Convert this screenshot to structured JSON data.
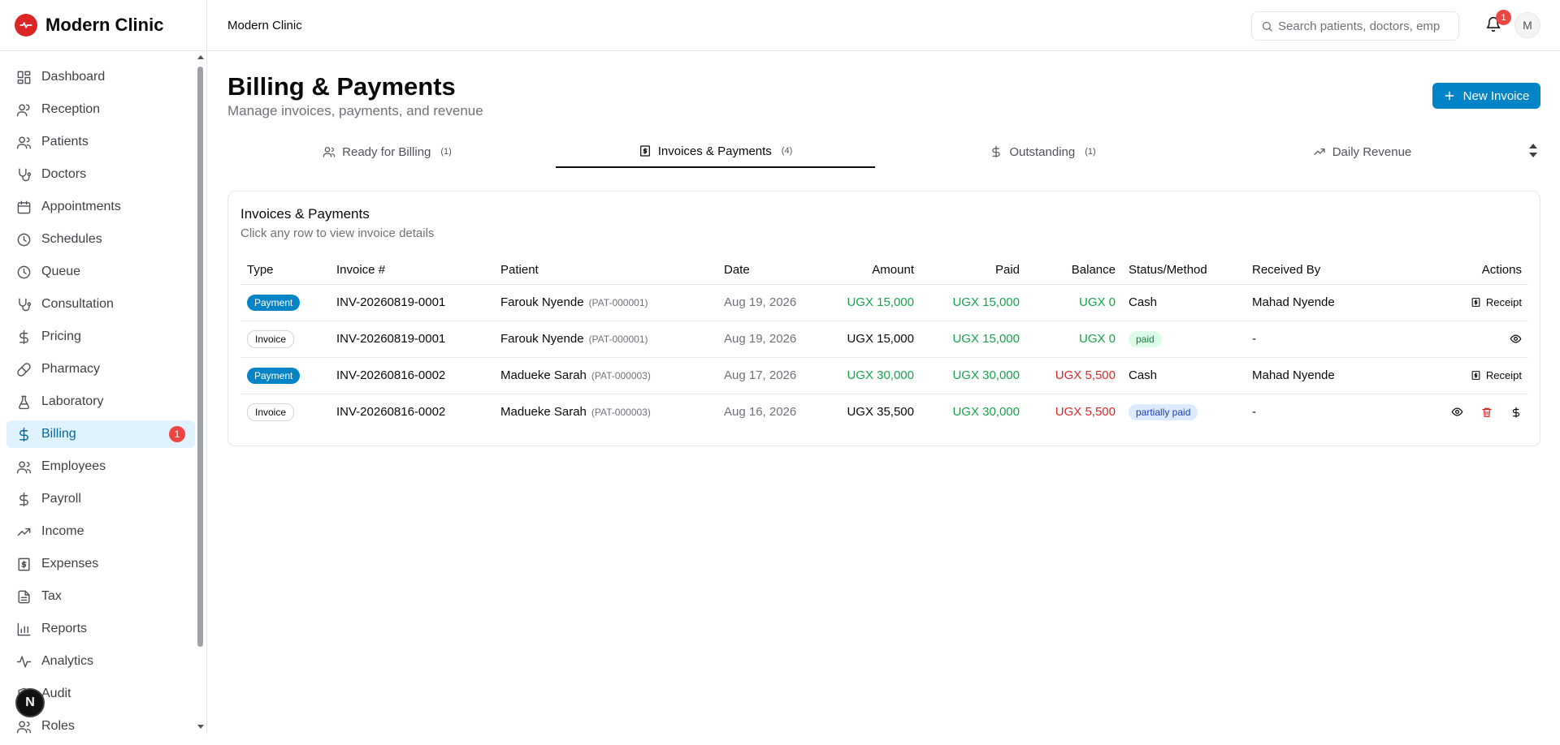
{
  "brand": {
    "name": "Modern Clinic",
    "color": "#dc2626"
  },
  "header": {
    "title": "Modern Clinic",
    "search_placeholder": "Search patients, doctors, emp",
    "notification_count": "1",
    "avatar_initial": "M"
  },
  "sidebar": {
    "items": [
      {
        "label": "Dashboard",
        "icon": "dashboard-icon"
      },
      {
        "label": "Reception",
        "icon": "user-icon"
      },
      {
        "label": "Patients",
        "icon": "users-icon"
      },
      {
        "label": "Doctors",
        "icon": "stethoscope-icon"
      },
      {
        "label": "Appointments",
        "icon": "calendar-icon"
      },
      {
        "label": "Schedules",
        "icon": "clock-icon"
      },
      {
        "label": "Queue",
        "icon": "clock-icon"
      },
      {
        "label": "Consultation",
        "icon": "stethoscope-icon"
      },
      {
        "label": "Pricing",
        "icon": "dollar-icon"
      },
      {
        "label": "Pharmacy",
        "icon": "pill-icon"
      },
      {
        "label": "Laboratory",
        "icon": "flask-icon"
      },
      {
        "label": "Billing",
        "icon": "dollar-icon",
        "badge": "1",
        "active": true
      },
      {
        "label": "Employees",
        "icon": "users-icon"
      },
      {
        "label": "Payroll",
        "icon": "dollar-icon"
      },
      {
        "label": "Income",
        "icon": "trending-up-icon"
      },
      {
        "label": "Expenses",
        "icon": "receipt-icon"
      },
      {
        "label": "Tax",
        "icon": "file-text-icon"
      },
      {
        "label": "Reports",
        "icon": "bar-chart-icon"
      },
      {
        "label": "Analytics",
        "icon": "activity-icon"
      },
      {
        "label": "Audit",
        "icon": "shield-icon"
      },
      {
        "label": "Roles",
        "icon": "users-icon"
      }
    ],
    "dev_badge": "N"
  },
  "page": {
    "title": "Billing & Payments",
    "subtitle": "Manage invoices, payments, and revenue",
    "new_invoice_label": "New Invoice"
  },
  "tabs": [
    {
      "label": "Ready for Billing",
      "count": "(1)"
    },
    {
      "label": "Invoices & Payments",
      "count": "(4)",
      "active": true
    },
    {
      "label": "Outstanding",
      "count": "(1)"
    },
    {
      "label": "Daily Revenue",
      "count": ""
    }
  ],
  "card": {
    "title": "Invoices & Payments",
    "description": "Click any row to view invoice details"
  },
  "table": {
    "columns": [
      "Type",
      "Invoice #",
      "Patient",
      "Date",
      "Amount",
      "Paid",
      "Balance",
      "Status/Method",
      "Received By",
      "Actions"
    ],
    "rows": [
      {
        "type": "Payment",
        "invoice": "INV-20260819-0001",
        "patient": "Farouk Nyende",
        "patient_id": "(PAT-000001)",
        "date": "Aug 19, 2026",
        "amount": "UGX 15,000",
        "paid": "UGX 15,000",
        "balance": "UGX 0",
        "status": "Cash",
        "received_by": "Mahad Nyende",
        "action_label": "Receipt"
      },
      {
        "type": "Invoice",
        "invoice": "INV-20260819-0001",
        "patient": "Farouk Nyende",
        "patient_id": "(PAT-000001)",
        "date": "Aug 19, 2026",
        "amount": "UGX 15,000",
        "paid": "UGX 15,000",
        "balance": "UGX 0",
        "status": "paid",
        "received_by": "-"
      },
      {
        "type": "Payment",
        "invoice": "INV-20260816-0002",
        "patient": "Madueke Sarah",
        "patient_id": "(PAT-000003)",
        "date": "Aug 17, 2026",
        "amount": "UGX 30,000",
        "paid": "UGX 30,000",
        "balance": "UGX 5,500",
        "status": "Cash",
        "received_by": "Mahad Nyende",
        "action_label": "Receipt"
      },
      {
        "type": "Invoice",
        "invoice": "INV-20260816-0002",
        "patient": "Madueke Sarah",
        "patient_id": "(PAT-000003)",
        "date": "Aug 16, 2026",
        "amount": "UGX 35,500",
        "paid": "UGX 30,000",
        "balance": "UGX 5,500",
        "status": "partially paid",
        "received_by": "-"
      }
    ]
  },
  "colors": {
    "accent": "#0284c7",
    "active_nav_bg": "#e0f2fe",
    "positive": "#16a34a",
    "negative": "#dc2626"
  }
}
